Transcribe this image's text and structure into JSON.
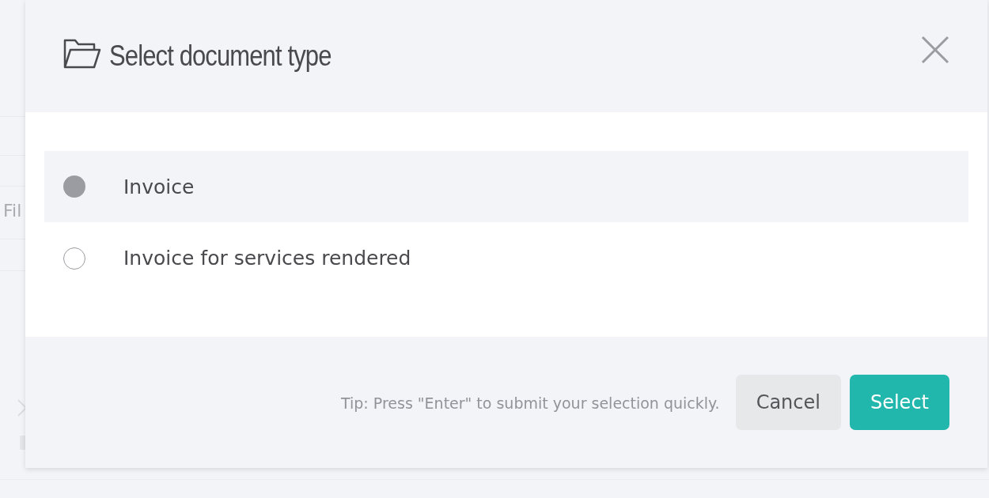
{
  "background": {
    "fragment": "Fil"
  },
  "dialog": {
    "title": "Select document type",
    "options": [
      {
        "label": "Invoice",
        "selected": true
      },
      {
        "label": "Invoice for services rendered",
        "selected": false
      }
    ],
    "tip": "Tip: Press \"Enter\" to submit your selection quickly.",
    "buttons": [
      {
        "label": "Cancel",
        "kind": "secondary"
      },
      {
        "label": "Select",
        "kind": "primary"
      }
    ]
  }
}
